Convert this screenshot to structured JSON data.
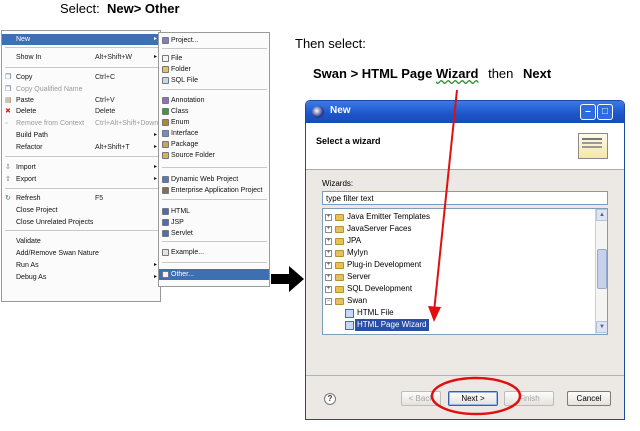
{
  "captions": {
    "select_prefix": "Select:",
    "select_path": "New> Other",
    "then_select": "Then select:",
    "step_path": "Swan > HTML Page",
    "step_wizard": "Wizard",
    "step_then": "then",
    "step_next": "Next"
  },
  "context_menu": {
    "items": [
      {
        "label": "New",
        "shortcut": "",
        "submenu": true,
        "selected": true,
        "disabled": false,
        "icon": ""
      },
      {
        "label": "Show In",
        "shortcut": "Alt+Shift+W",
        "submenu": true,
        "selected": false,
        "disabled": false,
        "icon": ""
      },
      {
        "label": "Copy",
        "shortcut": "Ctrl+C",
        "submenu": false,
        "selected": false,
        "disabled": false,
        "icon": "copy-icon"
      },
      {
        "label": "Copy Qualified Name",
        "shortcut": "",
        "submenu": false,
        "selected": false,
        "disabled": true,
        "icon": "copy-icon"
      },
      {
        "label": "Paste",
        "shortcut": "Ctrl+V",
        "submenu": false,
        "selected": false,
        "disabled": false,
        "icon": "paste-icon"
      },
      {
        "label": "Delete",
        "shortcut": "Delete",
        "submenu": false,
        "selected": false,
        "disabled": false,
        "icon": "delete-icon"
      },
      {
        "label": "Remove from Context",
        "shortcut": "Ctrl+Alt+Shift+Down",
        "submenu": false,
        "selected": false,
        "disabled": true,
        "icon": "remove-icon"
      },
      {
        "label": "Build Path",
        "shortcut": "",
        "submenu": true,
        "selected": false,
        "disabled": false,
        "icon": ""
      },
      {
        "label": "Refactor",
        "shortcut": "Alt+Shift+T",
        "submenu": true,
        "selected": false,
        "disabled": false,
        "icon": ""
      },
      {
        "label": "Import",
        "shortcut": "",
        "submenu": true,
        "selected": false,
        "disabled": false,
        "icon": "import-icon"
      },
      {
        "label": "Export",
        "shortcut": "",
        "submenu": true,
        "selected": false,
        "disabled": false,
        "icon": "export-icon"
      },
      {
        "label": "Refresh",
        "shortcut": "F5",
        "submenu": false,
        "selected": false,
        "disabled": false,
        "icon": "refresh-icon"
      },
      {
        "label": "Close Project",
        "shortcut": "",
        "submenu": false,
        "selected": false,
        "disabled": false,
        "icon": ""
      },
      {
        "label": "Close Unrelated Projects",
        "shortcut": "",
        "submenu": false,
        "selected": false,
        "disabled": false,
        "icon": ""
      },
      {
        "label": "Validate",
        "shortcut": "",
        "submenu": false,
        "selected": false,
        "disabled": false,
        "icon": ""
      },
      {
        "label": "Add/Remove Swan Nature",
        "shortcut": "",
        "submenu": false,
        "selected": false,
        "disabled": false,
        "icon": ""
      },
      {
        "label": "Run As",
        "shortcut": "",
        "submenu": true,
        "selected": false,
        "disabled": false,
        "icon": ""
      },
      {
        "label": "Debug As",
        "shortcut": "",
        "submenu": true,
        "selected": false,
        "disabled": false,
        "icon": ""
      }
    ]
  },
  "submenu": {
    "items": [
      {
        "label": "Project...",
        "color": "#7d7fc9"
      },
      {
        "label": "File",
        "color": "#f3f3f3"
      },
      {
        "label": "Folder",
        "color": "#e6c05a"
      },
      {
        "label": "SQL File",
        "color": "#c3d7ef"
      },
      {
        "label": "Annotation",
        "color": "#8e6fc7"
      },
      {
        "label": "Class",
        "color": "#3b9a46"
      },
      {
        "label": "Enum",
        "color": "#b08b2e"
      },
      {
        "label": "Interface",
        "color": "#6c8fd1"
      },
      {
        "label": "Package",
        "color": "#c7a45a"
      },
      {
        "label": "Source Folder",
        "color": "#d4b25e"
      },
      {
        "label": "Dynamic Web Project",
        "color": "#4f7bc0"
      },
      {
        "label": "Enterprise Application Project",
        "color": "#8a6e4a"
      },
      {
        "label": "HTML",
        "color": "#4b6eb6"
      },
      {
        "label": "JSP",
        "color": "#4b6eb6"
      },
      {
        "label": "Servlet",
        "color": "#4b6eb6"
      },
      {
        "label": "Example...",
        "color": "#e4e4e4"
      },
      {
        "label": "Other...",
        "color": "#f2f2f2"
      }
    ]
  },
  "dialog": {
    "title": "New",
    "heading": "Select a wizard",
    "wizards_label": "Wizards:",
    "filter_value": "type filter text",
    "tree": [
      {
        "label": "Java Emitter Templates",
        "expanded": false,
        "type": "folder",
        "level": 0
      },
      {
        "label": "JavaServer Faces",
        "expanded": false,
        "type": "folder",
        "level": 0
      },
      {
        "label": "JPA",
        "expanded": false,
        "type": "folder",
        "level": 0
      },
      {
        "label": "Mylyn",
        "expanded": false,
        "type": "folder",
        "level": 0
      },
      {
        "label": "Plug-in Development",
        "expanded": false,
        "type": "folder",
        "level": 0
      },
      {
        "label": "Server",
        "expanded": false,
        "type": "folder",
        "level": 0
      },
      {
        "label": "SQL Development",
        "expanded": false,
        "type": "folder",
        "level": 0
      },
      {
        "label": "Swan",
        "expanded": true,
        "type": "folder",
        "level": 0
      },
      {
        "label": "HTML File",
        "expanded": false,
        "type": "file",
        "level": 1
      },
      {
        "label": "HTML Page Wizard",
        "expanded": false,
        "type": "file",
        "level": 1,
        "selected": true
      }
    ],
    "buttons": {
      "help": "?",
      "back": "< Back",
      "next": "Next >",
      "finish": "Finish",
      "cancel": "Cancel"
    }
  },
  "colors": {
    "highlight": "#e01010",
    "menu_selection": "#3d6fb3",
    "titlebar": "#2356cc"
  }
}
